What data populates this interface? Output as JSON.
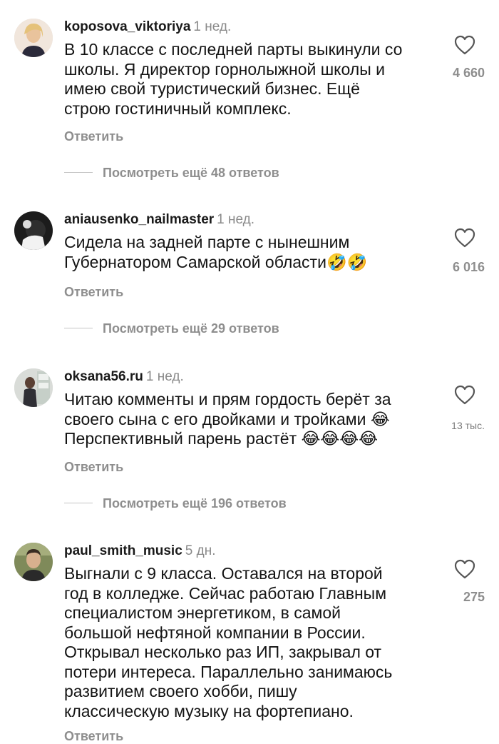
{
  "comments": [
    {
      "username": "koposova_viktoriya",
      "time": "1 нед.",
      "text": "В 10 классе с последней парты выкинули со\nшколы. Я директор горнолыжной школы и\nимею свой туристический бизнес. Ещё\nстрою гостиничный комплекс.",
      "reply_label": "Ответить",
      "more_label": "Посмотреть ещё 48 ответов",
      "likes": "4 660"
    },
    {
      "username": "aniausenko_nailmaster",
      "time": "1 нед.",
      "text": "Сидела на задней парте с нынешним\nГубернатором Самарской области🤣🤣",
      "reply_label": "Ответить",
      "more_label": "Посмотреть ещё 29 ответов",
      "likes": "6 016"
    },
    {
      "username": "oksana56.ru",
      "time": "1 нед.",
      "text": "Читаю комменты и прям гордость берёт за\nсвоего сына с его двойками и тройками 😂\nПерспективный парень растёт 😂😂😂😂",
      "reply_label": "Ответить",
      "more_label": "Посмотреть ещё 196 ответов",
      "likes": "13 тыс."
    },
    {
      "username": "paul_smith_music",
      "time": "5 дн.",
      "text": "Выгнали с 9 класса. Оставался на второй\nгод в колледже. Сейчас работаю Главным\nспециалистом энергетиком, в самой\nбольшой нефтяной компании в России.\nОткрывал несколько раз ИП, закрывал от\nпотери интереса. Параллельно занимаюсь\nразвитием своего хобби, пишу\nклассическую музыку на фортепиано.",
      "reply_label": "Ответить",
      "likes": "275"
    }
  ],
  "icons": {
    "like": "heart-outline-icon"
  },
  "colors": {
    "secondary_text": "#8e8e8e",
    "primary_text": "#141414"
  }
}
